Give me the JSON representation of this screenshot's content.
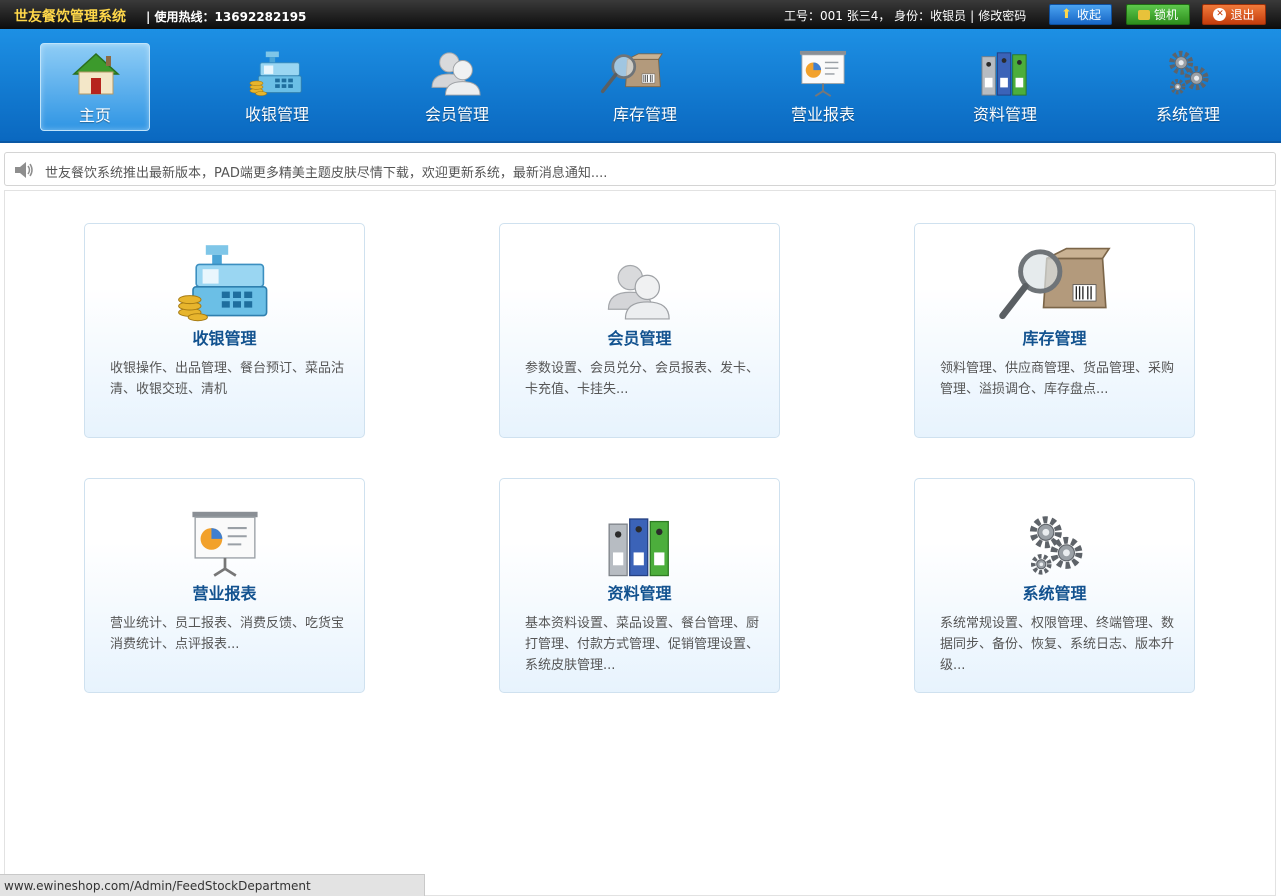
{
  "topbar": {
    "app_title": "世友餐饮管理系统",
    "hotline": "| 使用热线：13692282195",
    "user_info": "工号：001 张三4， 身份：收银员",
    "user_sep": "|",
    "change_password": "修改密码",
    "buttons": {
      "collapse": "收起",
      "lock": "锁机",
      "exit": "退出"
    }
  },
  "nav": {
    "items": [
      {
        "label": "主页",
        "icon": "home-icon"
      },
      {
        "label": "收银管理",
        "icon": "cash-register-icon"
      },
      {
        "label": "会员管理",
        "icon": "members-icon"
      },
      {
        "label": "库存管理",
        "icon": "inventory-icon"
      },
      {
        "label": "营业报表",
        "icon": "report-icon"
      },
      {
        "label": "资料管理",
        "icon": "binders-icon"
      },
      {
        "label": "系统管理",
        "icon": "gears-icon"
      }
    ]
  },
  "notice": {
    "text": "世友餐饮系统推出最新版本，PAD端更多精美主题皮肤尽情下载，欢迎更新系统，最新消息通知...."
  },
  "cards": [
    {
      "title": "收银管理",
      "desc": "收银操作、出品管理、餐台预订、菜品沽清、收银交班、清机",
      "icon": "cash-register-icon"
    },
    {
      "title": "会员管理",
      "desc": "参数设置、会员兑分、会员报表、发卡、卡充值、卡挂失...",
      "icon": "members-icon"
    },
    {
      "title": "库存管理",
      "desc": "领料管理、供应商管理、货品管理、采购管理、溢损调仓、库存盘点...",
      "icon": "inventory-icon"
    },
    {
      "title": "营业报表",
      "desc": "营业统计、员工报表、消费反馈、吃货宝消费统计、点评报表...",
      "icon": "report-icon"
    },
    {
      "title": "资料管理",
      "desc": "基本资料设置、菜品设置、餐台管理、厨打管理、付款方式管理、促销管理设置、系统皮肤管理...",
      "icon": "binders-icon"
    },
    {
      "title": "系统管理",
      "desc": "系统常规设置、权限管理、终端管理、数据同步、备份、恢复、系统日志、版本升级...",
      "icon": "gears-icon"
    }
  ],
  "statusbar": {
    "url": "www.ewineshop.com/Admin/FeedStockDepartment"
  }
}
